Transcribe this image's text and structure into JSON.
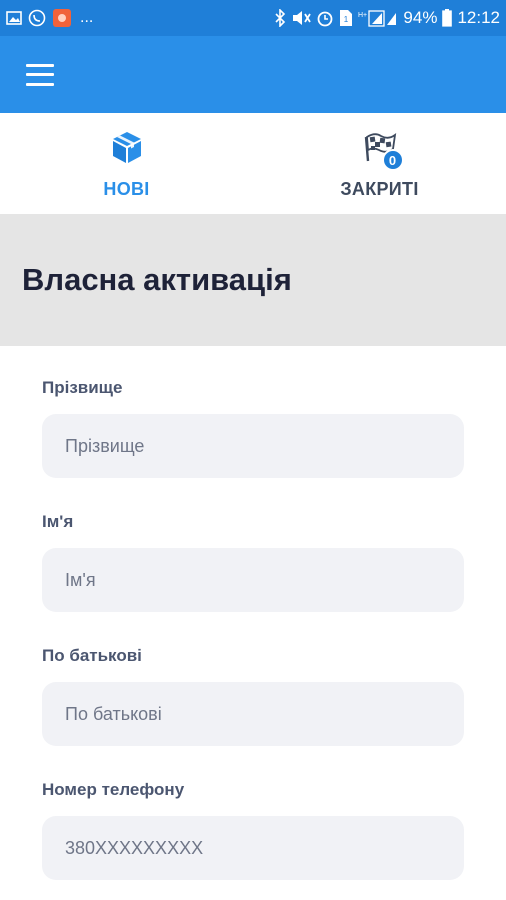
{
  "status_bar": {
    "battery": "94%",
    "time": "12:12",
    "dots": "...",
    "bg_color": "#1f7fd8",
    "left_icons": [
      "image-icon",
      "viber-icon",
      "app-notification-icon"
    ],
    "right_icons": [
      "bluetooth-icon",
      "mute-icon",
      "alarm-icon",
      "sim-icon",
      "signal-icon",
      "battery-icon"
    ]
  },
  "app_bar": {
    "bg_color": "#2a8fe8",
    "menu_icon": "hamburger-menu-icon"
  },
  "tabs": [
    {
      "label": "НОВІ",
      "icon": "box-icon",
      "active": true
    },
    {
      "label": "ЗАКРИТІ",
      "icon": "checkered-flag-icon",
      "badge": "0",
      "active": false
    }
  ],
  "section": {
    "title": "Власна активація"
  },
  "form": {
    "fields": [
      {
        "label": "Прізвище",
        "placeholder": "Прізвище",
        "value": ""
      },
      {
        "label": "Ім'я",
        "placeholder": "Ім'я",
        "value": ""
      },
      {
        "label": "По батькові",
        "placeholder": "По батькові",
        "value": ""
      },
      {
        "label": "Номер телефону",
        "placeholder": "380XXXXXXXXX",
        "value": ""
      }
    ]
  }
}
